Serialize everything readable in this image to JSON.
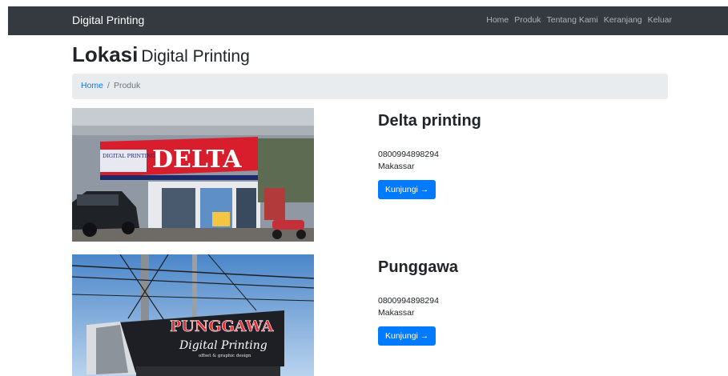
{
  "navbar": {
    "brand": "Digital Printing",
    "links": [
      "Home",
      "Produk",
      "Tentang Kami",
      "Keranjang",
      "Keluar"
    ]
  },
  "page": {
    "title_strong": "Lokasi",
    "title_light": "Digital Printing"
  },
  "breadcrumb": {
    "home": "Home",
    "separator": "/",
    "current": "Produk"
  },
  "locations": [
    {
      "name": "Delta printing",
      "phone": "0800994898294",
      "city": "Makassar",
      "button_label": "Kunjungi →",
      "photo": {
        "sign_small": "DIGITAL PRINTING",
        "sign_big": "DELTA"
      }
    },
    {
      "name": "Punggawa",
      "phone": "0800994898294",
      "city": "Makassar",
      "button_label": "Kunjungi →",
      "photo": {
        "sign_big": "PUNGGAWA",
        "sign_script": "Digital Printing",
        "sign_sub": "offset & graphic design"
      }
    }
  ],
  "colors": {
    "navbar_bg": "#343a40",
    "primary": "#007bff",
    "breadcrumb_bg": "#e9ecef"
  }
}
